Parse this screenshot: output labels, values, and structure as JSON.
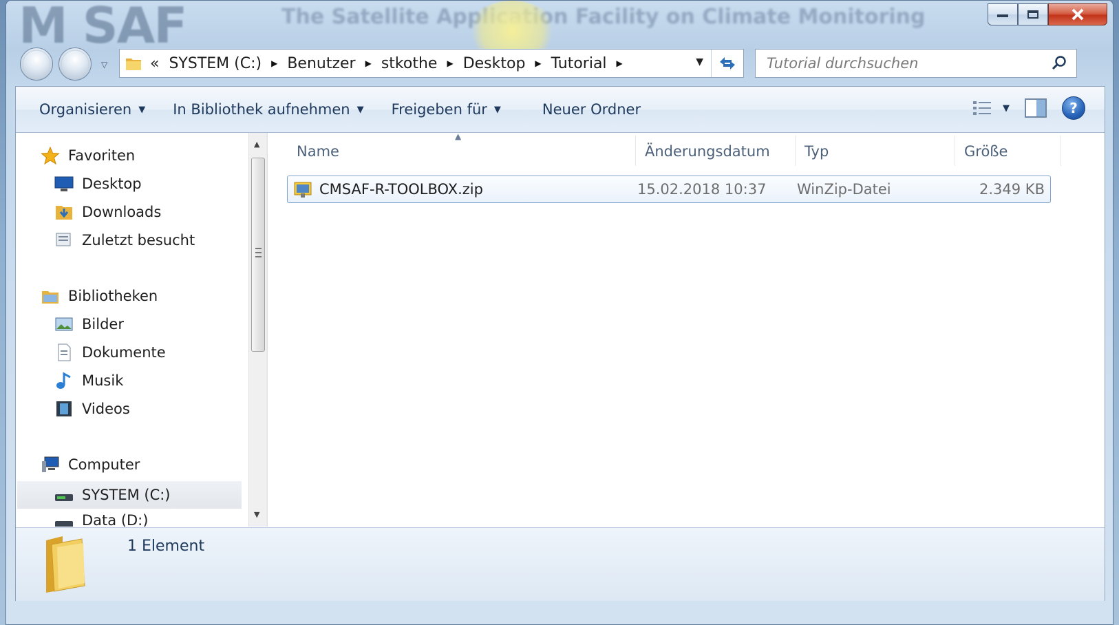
{
  "window": {
    "background_logo": "M SAF",
    "background_title": "The Satellite Application Facility on Climate Monitoring"
  },
  "address": {
    "overflow": "«",
    "crumbs": [
      "SYSTEM (C:)",
      "Benutzer",
      "stkothe",
      "Desktop",
      "Tutorial"
    ]
  },
  "search": {
    "placeholder": "Tutorial durchsuchen"
  },
  "toolbar": {
    "organize": "Organisieren",
    "library": "In Bibliothek aufnehmen",
    "share": "Freigeben für",
    "new_folder": "Neuer Ordner",
    "help": "?"
  },
  "nav": {
    "favorites": "Favoriten",
    "desktop": "Desktop",
    "downloads": "Downloads",
    "recent": "Zuletzt besucht",
    "libraries": "Bibliotheken",
    "pictures": "Bilder",
    "documents": "Dokumente",
    "music": "Musik",
    "videos": "Videos",
    "computer": "Computer",
    "system_c": "SYSTEM (C:)",
    "data_d": "Data (D:)"
  },
  "columns": {
    "name": "Name",
    "modified": "Änderungsdatum",
    "type": "Typ",
    "size": "Größe"
  },
  "files": [
    {
      "name": "CMSAF-R-TOOLBOX.zip",
      "modified": "15.02.2018 10:37",
      "type": "WinZip-Datei",
      "size": "2.349 KB"
    }
  ],
  "details": {
    "count": "1 Element"
  },
  "icons": {
    "back": "back-arrow-icon",
    "forward": "forward-arrow-icon",
    "refresh": "refresh-icon",
    "search": "search-icon",
    "view": "view-options-icon",
    "preview": "preview-pane-icon",
    "help": "help-icon",
    "zip": "zip-file-icon",
    "folder": "folder-icon"
  },
  "colors": {
    "accent": "#1e395b",
    "selection": "#7da2ce",
    "close": "#c2341a"
  }
}
